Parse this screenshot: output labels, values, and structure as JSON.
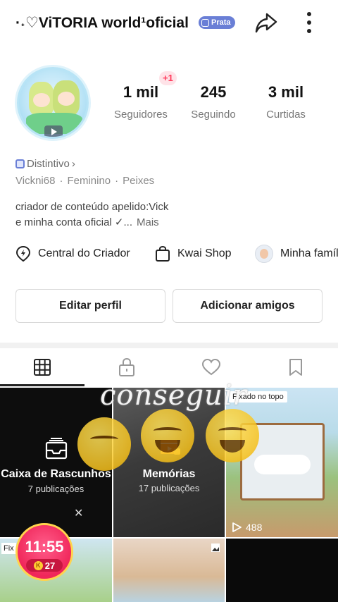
{
  "header": {
    "title": "·˖♡ViTORIA world¹oficial",
    "badge": "Prata",
    "share_icon": "share-arrow-icon",
    "more_icon": "vertical-dots-icon"
  },
  "profile": {
    "new_followers_badge": "+1",
    "stats": [
      {
        "value": "1 mil",
        "label": "Seguidores"
      },
      {
        "value": "245",
        "label": "Seguindo"
      },
      {
        "value": "3 mil",
        "label": "Curtidas"
      }
    ],
    "distintivo": "Distintivo",
    "username": "Vickni68",
    "gender": "Feminino",
    "sign": "Peixes",
    "bio_line1": "criador de conteúdo  apelido:Vick",
    "bio_line2": "e minha conta oficial ✓...",
    "bio_more": "Mais"
  },
  "shortcuts": [
    {
      "label": "Central do Criador",
      "icon": "lightning-pin-icon"
    },
    {
      "label": "Kwai Shop",
      "icon": "shopping-bag-icon"
    },
    {
      "label": "Minha família",
      "icon": "family-avatar-icon"
    }
  ],
  "actions": {
    "edit_profile": "Editar perfil",
    "add_friends": "Adicionar amigos"
  },
  "tabs": [
    {
      "name": "posts",
      "icon": "grid-icon",
      "active": true
    },
    {
      "name": "private",
      "icon": "lock-icon",
      "active": false
    },
    {
      "name": "liked",
      "icon": "heart-icon",
      "active": false
    },
    {
      "name": "saved",
      "icon": "bookmark-icon",
      "active": false
    }
  ],
  "grid": {
    "drafts_title": "Caixa de Rascunhos",
    "drafts_count": "7 publicações",
    "memories_title": "Memórias",
    "memories_count": "17 publicações",
    "pinned_label": "Fixado no topo",
    "pinned_views": "488",
    "row2_pin_label": "Fix"
  },
  "overlay": {
    "sticker_text": "conseguir",
    "timer": "11:55",
    "coins": "27"
  }
}
